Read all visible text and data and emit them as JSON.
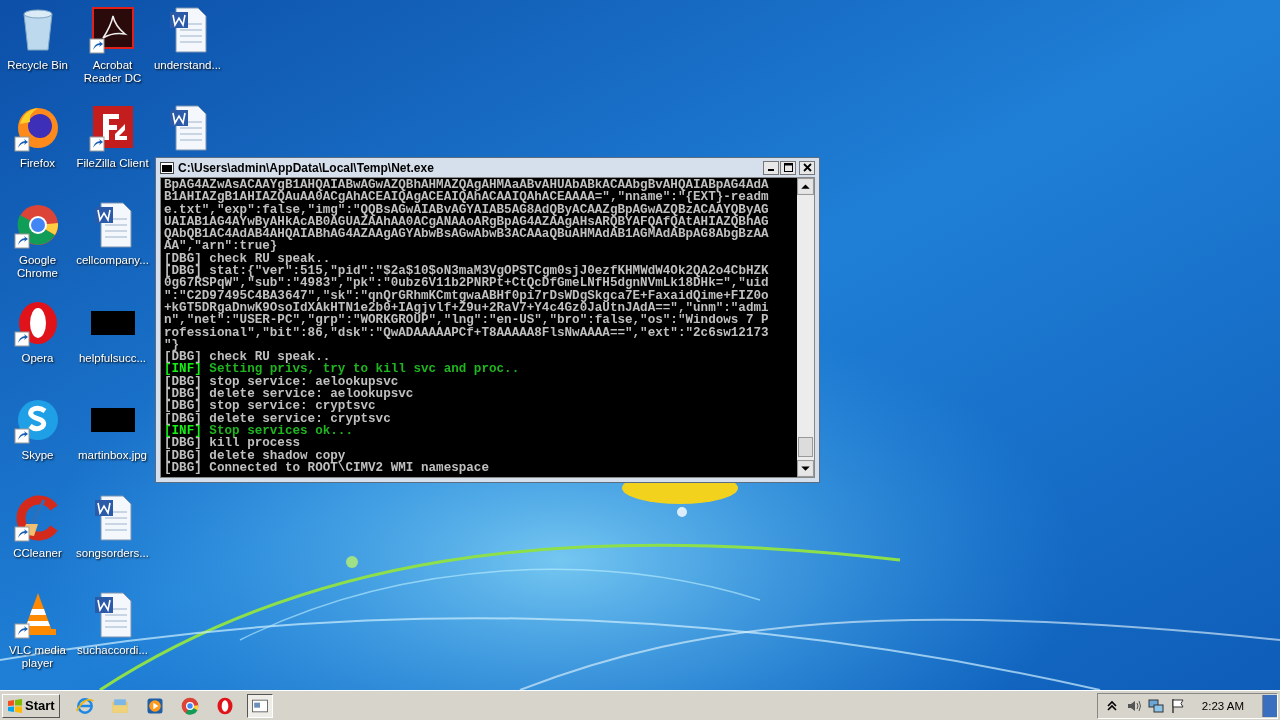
{
  "desktop_icons": [
    {
      "label": "Recycle Bin",
      "kind": "recycle-bin",
      "shortcut": false
    },
    {
      "label": "Firefox",
      "kind": "firefox",
      "shortcut": true
    },
    {
      "label": "Google Chrome",
      "kind": "chrome",
      "shortcut": true
    },
    {
      "label": "Opera",
      "kind": "opera",
      "shortcut": true
    },
    {
      "label": "Skype",
      "kind": "skype",
      "shortcut": true
    },
    {
      "label": "CCleaner",
      "kind": "ccleaner",
      "shortcut": true
    },
    {
      "label": "VLC media player",
      "kind": "vlc",
      "shortcut": true
    },
    {
      "label": "Acrobat Reader DC",
      "kind": "pdf",
      "shortcut": true
    },
    {
      "label": "FileZilla Client",
      "kind": "filezilla",
      "shortcut": true
    },
    {
      "label": "cellcompany...",
      "kind": "word-doc",
      "shortcut": false
    },
    {
      "label": "helpfulsucc...",
      "kind": "black-thumb",
      "shortcut": false
    },
    {
      "label": "martinbox.jpg",
      "kind": "black-thumb",
      "shortcut": false
    },
    {
      "label": "songsorders...",
      "kind": "word-doc",
      "shortcut": false
    },
    {
      "label": "suchaccordi...",
      "kind": "word-doc",
      "shortcut": false
    },
    {
      "label": "understand...",
      "kind": "word-doc",
      "shortcut": false
    },
    {
      "kind": "word-doc",
      "shortcut": false
    }
  ],
  "console_window": {
    "title": "C:\\Users\\admin\\AppData\\Local\\Temp\\Net.exe",
    "lines": [
      {
        "kind": "plain",
        "text": "BpAG4AZwAsACAAYgB1AHQAIABwAGwAZQBhAHMAZQAgAHMAaABvAHUAbABkACAAbgBvAHQAIABpAG4AdA"
      },
      {
        "kind": "plain",
        "text": "B1AHIAZgB1AHIAZQAuAA0ACgAhACEAIQAgACEAIQAhACAAIQAhACEAAAA=\",\"nname\":\"{EXT}-readm"
      },
      {
        "kind": "plain",
        "text": "e.txt\",\"exp\":false,\"img\":\"QQBsAGwAIABvAGYAIAB5AG8AdQByACAAZgBpAGwAZQBzACAAYQByAG"
      },
      {
        "kind": "plain",
        "text": "UAIAB1AG4AYwByAHkAcAB0AGUAZAAhAA0ACgANAAoARgBpAG4AZAAgAHsARQBYAFQAfQAtAHIAZQBhAG"
      },
      {
        "kind": "plain",
        "text": "QAbQB1AC4AdAB4AHQAIABhAG4AZAAgAGYAbwBsAGwAbwB3ACAAaQBuAHMAdAB1AGMAdABpAG8AbgBzAA"
      },
      {
        "kind": "plain",
        "text": "AA\",\"arn\":true}"
      },
      {
        "kind": "dbg",
        "tag": "[DBG]",
        "text": " check RU speak.."
      },
      {
        "kind": "dbg",
        "tag": "[DBG]",
        "text": " stat:{\"ver\":515,\"pid\":\"$2a$10$oN3maM3VgOPSTCgm0sjJ0ezfKHMWdW4Ok2QA2o4CbHZK"
      },
      {
        "kind": "plain",
        "text": "0g67RSPqW\",\"sub\":\"4983\",\"pk\":\"0ubz6V11b2PNRPt+CtQcDfGmeLNfH5dgnNVmLk18DHk=\",\"uid"
      },
      {
        "kind": "plain",
        "text": "\":\"C2D97495C4BA3647\",\"sk\":\"qnQrGRhmKCmtgwaABHf0pi7rDsWDgSkgca7E+FaxaidQime+FIZ0o"
      },
      {
        "kind": "plain",
        "text": "+kGT5DRgaDnwK9OsoIdXAkHTN1e2b0+IAgjvlf+Z9u+2RaV7+Y4c4Gz0JaUtnJAdA==\",\"unm\":\"admi"
      },
      {
        "kind": "plain",
        "text": "n\",\"net\":\"USER-PC\",\"grp\":\"WORKGROUP\",\"lng\":\"en-US\",\"bro\":false,\"os\":\"Windows 7 P"
      },
      {
        "kind": "plain",
        "text": "rofessional\",\"bit\":86,\"dsk\":\"QwADAAAAAPCf+T8AAAAA8FlsNwAAAA==\",\"ext\":\"2c6sw12173"
      },
      {
        "kind": "plain",
        "text": "\"}"
      },
      {
        "kind": "dbg",
        "tag": "[DBG]",
        "text": " check RU speak.."
      },
      {
        "kind": "inf",
        "tag": "[INF]",
        "text": " Setting privs, try to kill svc and proc.."
      },
      {
        "kind": "dbg",
        "tag": "[DBG]",
        "text": " stop service: aelookupsvc"
      },
      {
        "kind": "dbg",
        "tag": "[DBG]",
        "text": " delete service: aelookupsvc"
      },
      {
        "kind": "dbg",
        "tag": "[DBG]",
        "text": " stop service: cryptsvc"
      },
      {
        "kind": "dbg",
        "tag": "[DBG]",
        "text": " delete service: cryptsvc"
      },
      {
        "kind": "inf",
        "tag": "[INF]",
        "text": " Stop services ok..."
      },
      {
        "kind": "dbg",
        "tag": "[DBG]",
        "text": " kill process"
      },
      {
        "kind": "dbg",
        "tag": "[DBG]",
        "text": " delete shadow copy"
      },
      {
        "kind": "dbg",
        "tag": "[DBG]",
        "text": " Connected to ROOT\\CIMV2 WMI namespace"
      }
    ]
  },
  "taskbar": {
    "start": "Start",
    "apps": [
      {
        "kind": "ie",
        "selected": false
      },
      {
        "kind": "explorer",
        "selected": false
      },
      {
        "kind": "media",
        "selected": false
      },
      {
        "kind": "chrome",
        "selected": false
      },
      {
        "kind": "opera",
        "selected": false
      },
      {
        "kind": "console",
        "selected": true
      }
    ],
    "clock": "2:23 AM"
  }
}
